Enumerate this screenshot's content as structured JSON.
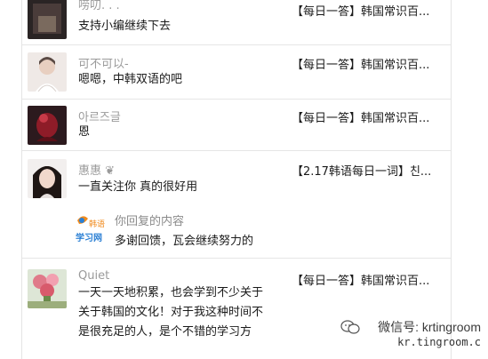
{
  "comments": [
    {
      "name": "唠叨. . .",
      "message": "支持小编继续下去",
      "article": "【每日一答】韩国常识百..."
    },
    {
      "name": "可不可以-",
      "message": "嗯嗯，中韩双语的吧",
      "article": "【每日一答】韩国常识百..."
    },
    {
      "name": "아르즈글",
      "message": "恩",
      "article": "【每日一答】韩国常识百..."
    },
    {
      "name": "惠惠 ❦",
      "message": "一直关注你 真的很好用",
      "article": "【2.17韩语每日一词】친..."
    },
    {
      "name": "Quiet",
      "message_lines": [
        "一天一天地积累，也会学到不少关于",
        "关于韩国的文化！对于我这种时间不",
        "是很充足的人，是个不错的学习方"
      ],
      "article": "【每日一答】韩国常识百..."
    }
  ],
  "reply": {
    "title": "你回复的内容",
    "message": "多谢回馈，瓦会继续努力的",
    "logo_top": "韩语",
    "logo_bottom": "学习网"
  },
  "watermark": {
    "line1": "微信号: krtingroom",
    "line2": "kr.tingroom.c"
  },
  "colors": {
    "divider": "#e6e6e6",
    "name_gray": "#9a9a9a",
    "logo_blue": "#2a7fd4",
    "logo_orange": "#f08a1c"
  }
}
